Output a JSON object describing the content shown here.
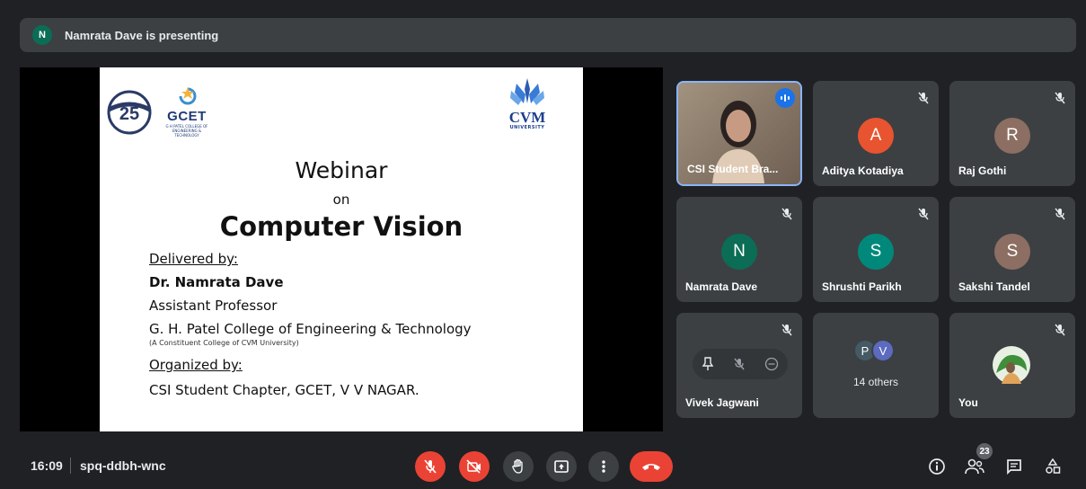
{
  "banner": {
    "avatar_letter": "N",
    "text": "Namrata Dave is presenting"
  },
  "slide": {
    "gcet_logo": {
      "name": "GCET",
      "sub": "G H PATEL COLLEGE OF ENGINEERING & TECHNOLOGY"
    },
    "cvm_logo": {
      "name": "CVM",
      "sub": "UNIVERSITY"
    },
    "title": "Webinar",
    "on": "on",
    "topic": "Computer Vision",
    "delivered_label": "Delivered by:",
    "speaker": "Dr. Namrata Dave",
    "designation": "Assistant Professor",
    "college": "G. H. Patel College of Engineering & Technology",
    "college_note": "(A Constituent College of CVM University)",
    "organized_label": "Organized by:",
    "organizer": "CSI Student Chapter, GCET, V V NAGAR."
  },
  "participants": {
    "p1": {
      "name": "CSI Student Bra..."
    },
    "p2": {
      "name": "Aditya Kotadiya",
      "letter": "A",
      "color": "#e8542f"
    },
    "p3": {
      "name": "Raj Gothi",
      "letter": "R",
      "color": "#8d6e63"
    },
    "p4": {
      "name": "Namrata Dave",
      "letter": "N",
      "color": "#0b6d55"
    },
    "p5": {
      "name": "Shrushti Parikh",
      "letter": "S",
      "color": "#00897b"
    },
    "p6": {
      "name": "Sakshi Tandel",
      "letter": "S",
      "color": "#8d6e63"
    },
    "p7": {
      "name": "Vivek Jagwani"
    },
    "p8": {
      "label": "14 others",
      "letter_a": "P",
      "letter_b": "V"
    },
    "p9": {
      "name": "You"
    }
  },
  "bottom": {
    "time": "16:09",
    "meeting_code": "spq-ddbh-wnc",
    "people_count": "23"
  }
}
